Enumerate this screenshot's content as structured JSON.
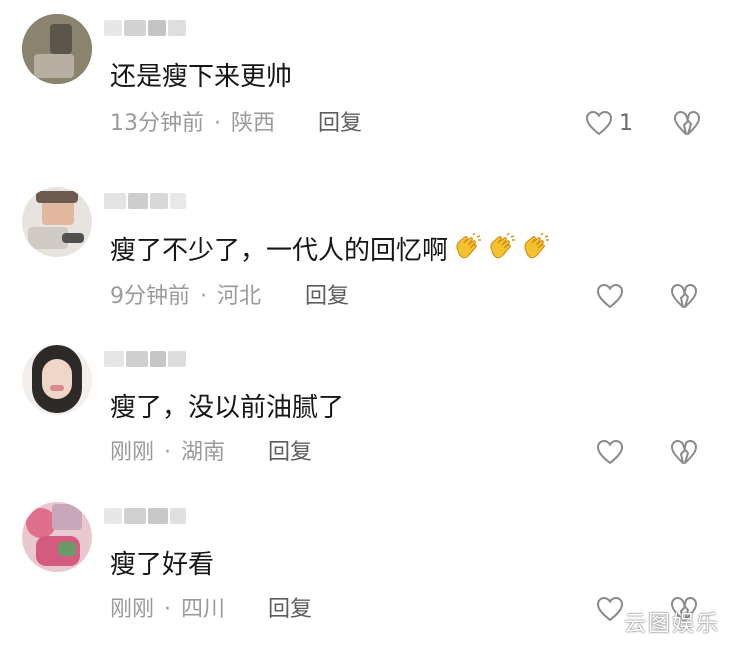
{
  "comments": [
    {
      "text": "还是瘦下来更帅",
      "time": "13分钟前",
      "location": "陕西",
      "reply": "回复",
      "likes": "1"
    },
    {
      "text": "瘦了不少了，一代人的回忆啊",
      "time": "9分钟前",
      "location": "河北",
      "reply": "回复",
      "emoji": [
        "clapping-hands",
        "clapping-hands",
        "clapping-hands"
      ]
    },
    {
      "text": "瘦了，没以前油腻了",
      "time": "刚刚",
      "location": "湖南",
      "reply": "回复"
    },
    {
      "text": "瘦了好看",
      "time": "刚刚",
      "location": "四川",
      "reply": "回复"
    }
  ],
  "meta_separator": "·",
  "watermark": "云图娱乐",
  "colors": {
    "text": "#161616",
    "meta": "#9a9a9a",
    "reply": "#5d5d5d",
    "icon": "#8a8a8a"
  },
  "icons": {
    "like": "heart-outline-icon",
    "dislike": "broken-heart-icon",
    "emoji": "clapping-hands-icon"
  }
}
